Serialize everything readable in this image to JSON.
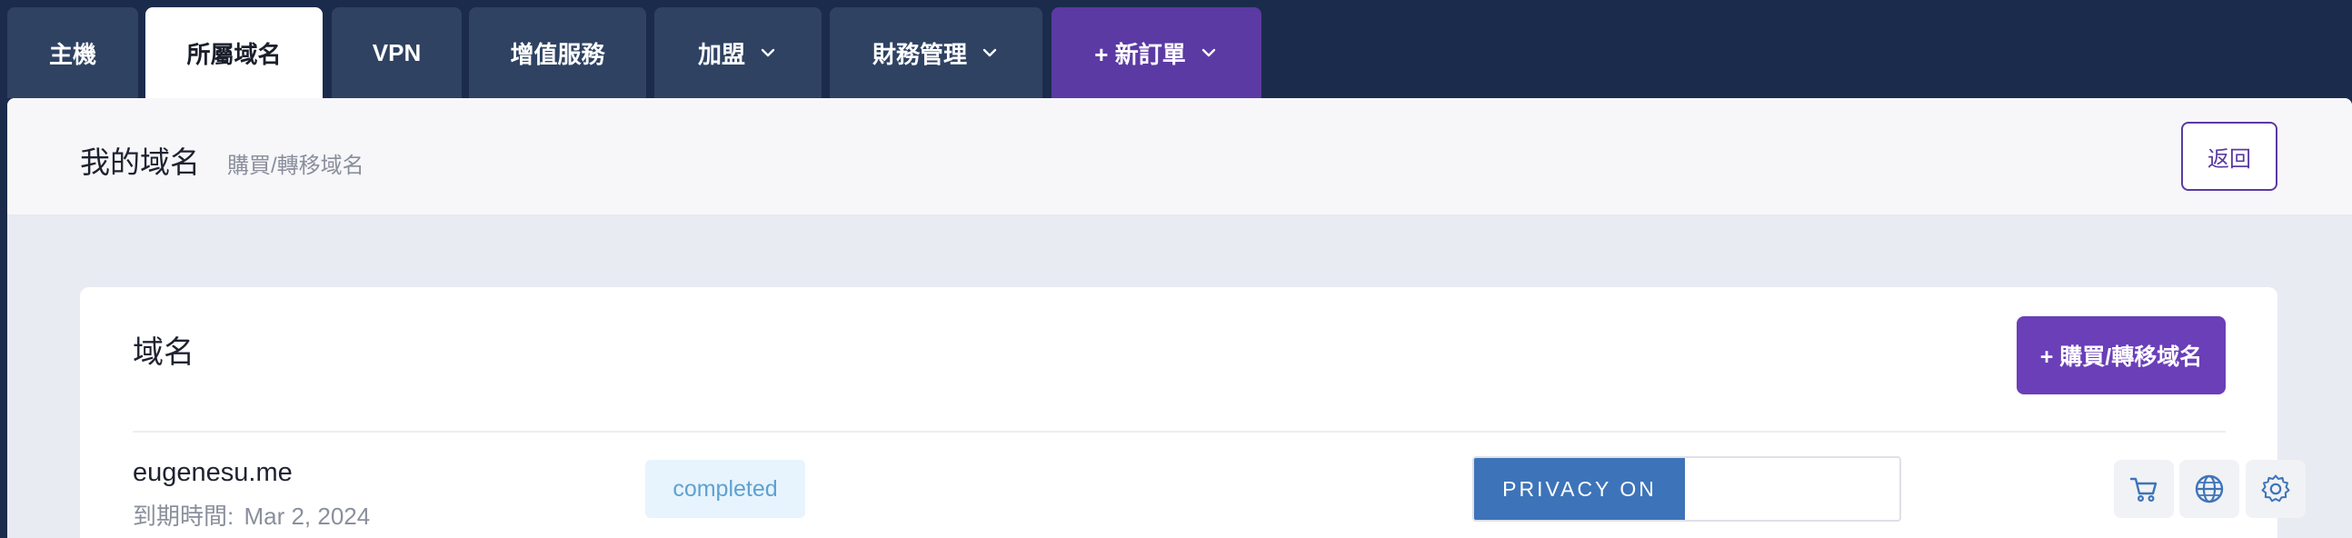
{
  "tabs": [
    {
      "label": "主機"
    },
    {
      "label": "所屬域名"
    },
    {
      "label": "VPN"
    },
    {
      "label": "增值服務"
    },
    {
      "label": "加盟"
    },
    {
      "label": "財務管理"
    },
    {
      "label": "+ 新訂單"
    }
  ],
  "page": {
    "title": "我的域名",
    "subtitle": "購買/轉移域名",
    "back_label": "返回"
  },
  "card": {
    "title": "域名",
    "buy_button_label": "+ 購買/轉移域名"
  },
  "domains": [
    {
      "name": "eugenesu.me",
      "expiry_label": "到期時間:",
      "expiry_date": "Mar 2, 2024",
      "status": "completed",
      "privacy_label": "PRIVACY ON",
      "actions": [
        "cart-icon",
        "globe-icon",
        "gear-icon"
      ]
    }
  ],
  "colors": {
    "nav_bg": "#1b2b4b",
    "tab_bg": "#2f4262",
    "accent": "#6a3fb8",
    "privacy_blue": "#3d74b9",
    "status_bg": "#e7f4fd",
    "status_text": "#5fa1cf"
  }
}
